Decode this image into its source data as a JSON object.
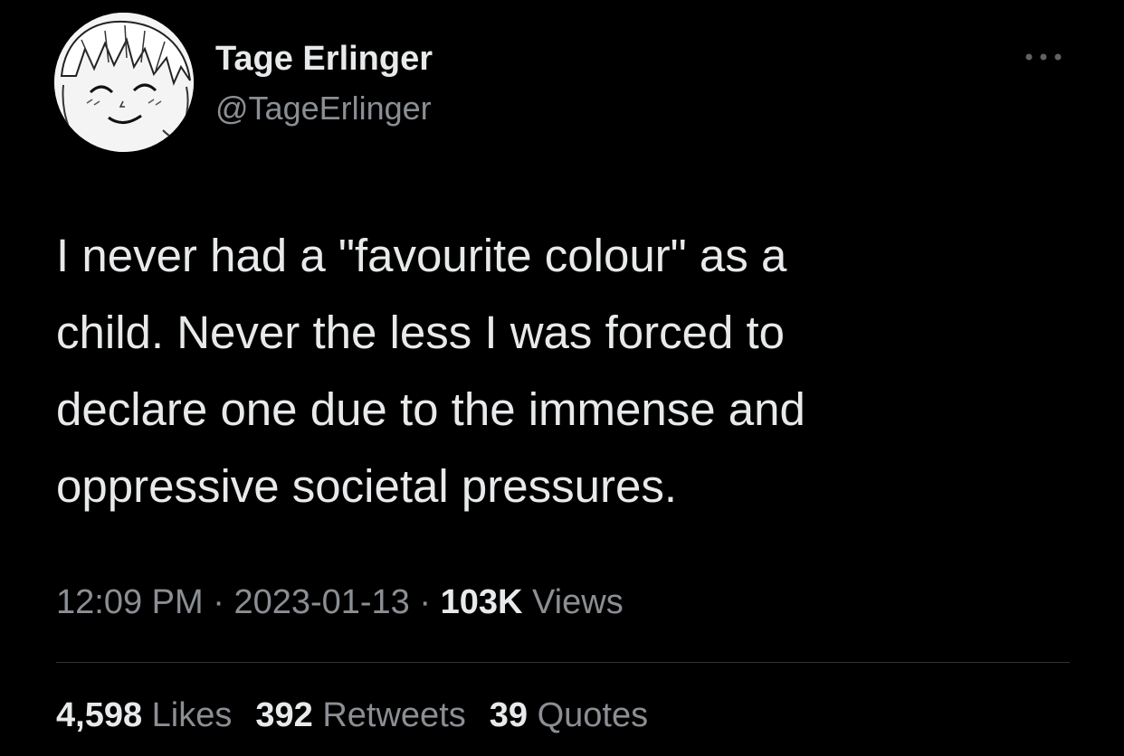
{
  "user": {
    "name": "Tage Erlinger",
    "handle": "@TageErlinger",
    "avatar_icon": "anime-boy-avatar-icon"
  },
  "menu": {
    "icon": "more-options-icon"
  },
  "tweet": {
    "lines": [
      "I never had a \"favourite colour\" as a",
      "child. Never the less I was forced to",
      "declare one due to the immense and",
      "oppressive societal pressures."
    ]
  },
  "meta": {
    "time": "12:09 PM",
    "separator": " · ",
    "date": "2023-01-13",
    "views_count": "103K",
    "views_label": "Views"
  },
  "stats": {
    "likes_count": "4,598",
    "likes_label": "Likes",
    "retweets_count": "392",
    "retweets_label": "Retweets",
    "quotes_count": "39",
    "quotes_label": "Quotes"
  },
  "colors": {
    "background": "#000000",
    "primary_text": "#e7e9ea",
    "secondary_text": "#8b8f94",
    "divider": "#2f3336"
  }
}
